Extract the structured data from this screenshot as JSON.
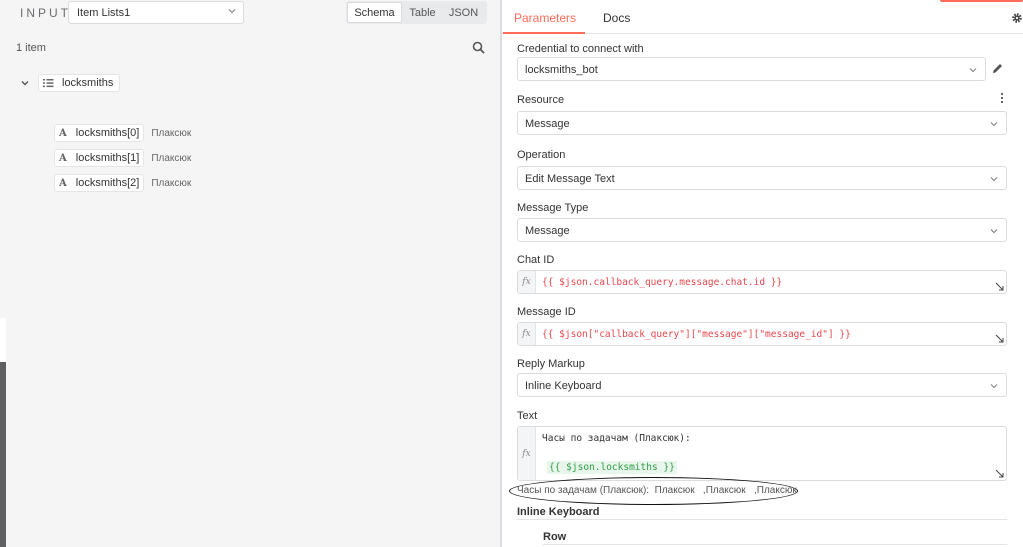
{
  "input_panel": {
    "label": "INPUT",
    "node_select": "Item Lists1",
    "view_tabs": [
      "Schema",
      "Table",
      "JSON"
    ],
    "active_view": "Schema",
    "item_count": "1 item",
    "tree": {
      "root": "locksmiths",
      "children": [
        {
          "key": "locksmiths[0]",
          "value": "Плаксюк",
          "type": "A"
        },
        {
          "key": "locksmiths[1]",
          "value": "Плаксюк",
          "type": "A"
        },
        {
          "key": "locksmiths[2]",
          "value": "Плаксюк",
          "type": "A"
        }
      ]
    }
  },
  "params_panel": {
    "tabs": [
      "Parameters",
      "Docs"
    ],
    "active_tab": "Parameters",
    "credential": {
      "label": "Credential to connect with",
      "value": "locksmiths_bot"
    },
    "resource": {
      "label": "Resource",
      "value": "Message"
    },
    "operation": {
      "label": "Operation",
      "value": "Edit Message Text"
    },
    "message_type": {
      "label": "Message Type",
      "value": "Message"
    },
    "chat_id": {
      "label": "Chat ID",
      "fx": "fx",
      "expression": "{{ $json.callback_query.message.chat.id }}"
    },
    "message_id": {
      "label": "Message ID",
      "fx": "fx",
      "expression": "{{ $json[\"callback_query\"][\"message\"][\"message_id\"] }}"
    },
    "reply_markup": {
      "label": "Reply Markup",
      "value": "Inline Keyboard"
    },
    "text": {
      "label": "Text",
      "fx": "fx",
      "line1": "Часы по задачам (Плаксюк):",
      "expression": "{{ $json.locksmiths }}",
      "preview": "Часы по задачам (Плаксюк):  Плаксюк   ,Плаксюк   ,Плаксюк"
    },
    "inline_keyboard": {
      "label": "Inline Keyboard",
      "row_label": "Row"
    }
  },
  "colors": {
    "accent": "#ff6d5a",
    "expression_red": "#e5484d",
    "expression_green": "#2f9e44"
  }
}
